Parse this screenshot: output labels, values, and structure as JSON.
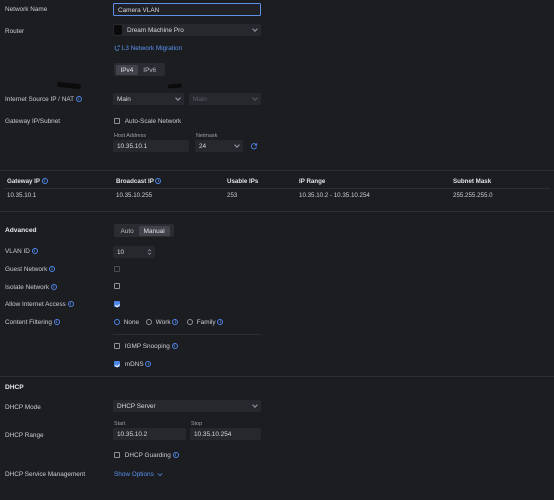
{
  "network_name": {
    "label": "Network Name",
    "value": "Camera VLAN"
  },
  "router": {
    "label": "Router",
    "value": "Dream Machine Pro",
    "migration_link": "L3 Network Migration"
  },
  "ip_version": {
    "options": [
      "IPv4",
      "IPv6"
    ],
    "selected": "IPv4"
  },
  "internet_source": {
    "label": "Internet Source IP / NAT",
    "value": "Main",
    "secondary_value": "Main"
  },
  "gateway": {
    "label": "Gateway IP/Subnet",
    "auto_scale_label": "Auto-Scale Network",
    "auto_scale_checked": false,
    "host_label": "Host Address",
    "host_value": "10.35.10.1",
    "netmask_label": "Netmask",
    "netmask_value": "24"
  },
  "table": {
    "headers": [
      "Gateway IP",
      "Broadcast IP",
      "Usable IPs",
      "IP Range",
      "Subnet Mask"
    ],
    "row": [
      "10.35.10.1",
      "10.35.10.255",
      "253",
      "10.35.10.2 - 10.35.10.254",
      "255.255.255.0"
    ]
  },
  "advanced": {
    "title": "Advanced",
    "mode_options": [
      "Auto",
      "Manual"
    ],
    "mode_selected": "Manual",
    "vlan_label": "VLAN ID",
    "vlan_value": "10",
    "guest_label": "Guest Network",
    "isolate_label": "Isolate Network",
    "internet_access_label": "Allow Internet Access",
    "content_filtering_label": "Content Filtering",
    "content_filtering_options": [
      "None",
      "Work",
      "Family"
    ],
    "content_filtering_selected": "None",
    "igmp_label": "IGMP Snooping",
    "mdns_label": "mDNS"
  },
  "dhcp": {
    "title": "DHCP",
    "mode_label": "DHCP Mode",
    "mode_value": "DHCP Server",
    "range_label": "DHCP Range",
    "start_label": "Start",
    "start_value": "10.35.10.2",
    "stop_label": "Stop",
    "stop_value": "10.35.10.254",
    "guarding_label": "DHCP Guarding",
    "service_label": "DHCP Service Management",
    "show_options": "Show Options"
  },
  "colors": {
    "accent": "#4e86e8",
    "background": "#1c1d21",
    "field": "#26282d"
  }
}
